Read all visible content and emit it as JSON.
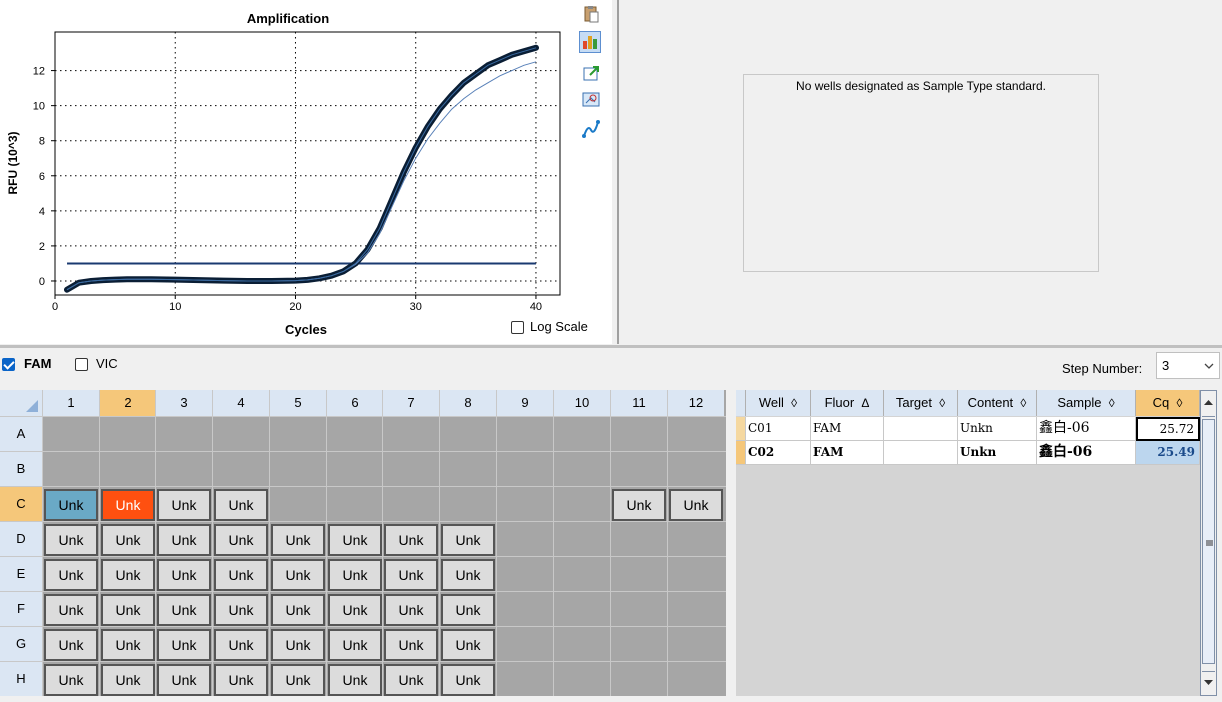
{
  "chart": {
    "title": "Amplification",
    "xlabel": "Cycles",
    "ylabel": "RFU (10^3)",
    "log_scale_label": "Log Scale",
    "log_scale_checked": false
  },
  "chart_data": {
    "type": "line",
    "title": "Amplification",
    "xlabel": "Cycles",
    "ylabel": "RFU (10^3)",
    "xlim": [
      0,
      42
    ],
    "ylim": [
      -0.8,
      14.2
    ],
    "xticks": [
      0,
      10,
      20,
      30,
      40
    ],
    "yticks": [
      0,
      2,
      4,
      6,
      8,
      10,
      12
    ],
    "grid": true,
    "threshold": 1.0,
    "series": [
      {
        "name": "C01",
        "x": [
          1,
          2,
          3,
          4,
          5,
          6,
          8,
          10,
          12,
          14,
          16,
          18,
          20,
          21,
          22,
          23,
          24,
          25,
          26,
          27,
          28,
          29,
          30,
          31,
          32,
          33,
          34,
          35,
          36,
          37,
          38,
          39,
          40
        ],
        "y": [
          -0.5,
          -0.1,
          0,
          0.05,
          0.08,
          0.1,
          0.1,
          0.08,
          0.05,
          0.02,
          0,
          0,
          0.02,
          0.06,
          0.15,
          0.3,
          0.55,
          1.0,
          1.8,
          3.0,
          4.6,
          6.2,
          7.6,
          8.8,
          9.8,
          10.6,
          11.3,
          11.8,
          12.3,
          12.6,
          12.9,
          13.1,
          13.3
        ],
        "color": "#0a1e35",
        "width": 5
      },
      {
        "name": "C02",
        "x": [
          1,
          2,
          3,
          4,
          5,
          6,
          8,
          10,
          12,
          14,
          16,
          18,
          20,
          21,
          22,
          23,
          24,
          25,
          26,
          27,
          28,
          29,
          30,
          31,
          32,
          33,
          34,
          35,
          36,
          37,
          38,
          39,
          40
        ],
        "y": [
          -0.5,
          -0.1,
          0,
          0.05,
          0.08,
          0.1,
          0.1,
          0.08,
          0.05,
          0.02,
          0,
          0,
          0.02,
          0.06,
          0.15,
          0.3,
          0.55,
          0.95,
          1.6,
          2.7,
          4.2,
          5.7,
          7.0,
          8.1,
          9.0,
          9.8,
          10.4,
          10.9,
          11.3,
          11.7,
          12.0,
          12.3,
          12.5
        ],
        "color": "#5880b8",
        "width": 1
      }
    ]
  },
  "standard": {
    "message": "No wells designated as Sample Type standard."
  },
  "fluors": [
    {
      "label": "FAM",
      "checked": true
    },
    {
      "label": "VIC",
      "checked": false
    }
  ],
  "step": {
    "label": "Step Number:",
    "value": "3"
  },
  "plate": {
    "cols": [
      "1",
      "2",
      "3",
      "4",
      "5",
      "6",
      "7",
      "8",
      "9",
      "10",
      "11",
      "12"
    ],
    "rows": [
      "A",
      "B",
      "C",
      "D",
      "E",
      "F",
      "G",
      "H"
    ],
    "selected_row": "C",
    "selected_col": "2",
    "cells": {
      "C": {
        "1": "Unk",
        "2": "Unk",
        "3": "Unk",
        "4": "Unk",
        "11": "Unk",
        "12": "Unk"
      },
      "D": {
        "1": "Unk",
        "2": "Unk",
        "3": "Unk",
        "4": "Unk",
        "5": "Unk",
        "6": "Unk",
        "7": "Unk",
        "8": "Unk"
      },
      "E": {
        "1": "Unk",
        "2": "Unk",
        "3": "Unk",
        "4": "Unk",
        "5": "Unk",
        "6": "Unk",
        "7": "Unk",
        "8": "Unk"
      },
      "F": {
        "1": "Unk",
        "2": "Unk",
        "3": "Unk",
        "4": "Unk",
        "5": "Unk",
        "6": "Unk",
        "7": "Unk",
        "8": "Unk"
      },
      "G": {
        "1": "Unk",
        "2": "Unk",
        "3": "Unk",
        "4": "Unk",
        "5": "Unk",
        "6": "Unk",
        "7": "Unk",
        "8": "Unk"
      },
      "H": {
        "1": "Unk",
        "2": "Unk",
        "3": "Unk",
        "4": "Unk",
        "5": "Unk",
        "6": "Unk",
        "7": "Unk",
        "8": "Unk"
      }
    }
  },
  "table": {
    "columns": [
      {
        "label": "Well",
        "sort": "◊"
      },
      {
        "label": "Fluor",
        "sort": "Δ"
      },
      {
        "label": "Target",
        "sort": "◊"
      },
      {
        "label": "Content",
        "sort": "◊"
      },
      {
        "label": "Sample",
        "sort": "◊"
      },
      {
        "label": "Cq",
        "sort": "◊"
      }
    ],
    "rows": [
      {
        "well": "C01",
        "fluor": "FAM",
        "target": "",
        "content": "Unkn",
        "sample": "鑫白-06",
        "cq": "25.72",
        "bold": false
      },
      {
        "well": "C02",
        "fluor": "FAM",
        "target": "",
        "content": "Unkn",
        "sample": "鑫白-06",
        "cq": "25.49",
        "bold": true
      }
    ]
  },
  "icons": [
    "clipboard-icon",
    "chart-settings-icon",
    "export-icon",
    "zoom-icon",
    "curve-icon"
  ]
}
